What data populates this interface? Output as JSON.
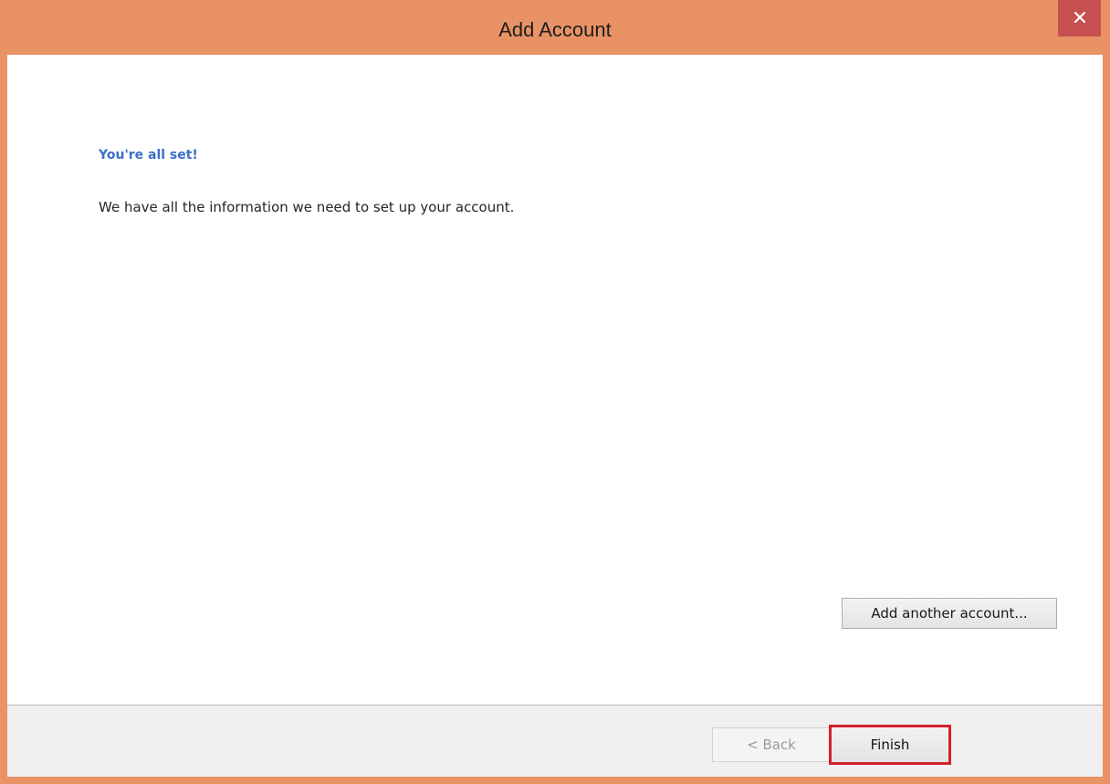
{
  "window": {
    "title": "Add Account",
    "close_icon": "close-icon",
    "accent_color": "#e99266",
    "close_color": "#c75050"
  },
  "content": {
    "heading": "You're all set!",
    "message": "We have all the information we need to set up your account.",
    "heading_color": "#3a6fc8"
  },
  "buttons": {
    "add_another": "Add another account...",
    "back": "< Back",
    "finish": "Finish",
    "highlight_color": "#d6202c"
  }
}
